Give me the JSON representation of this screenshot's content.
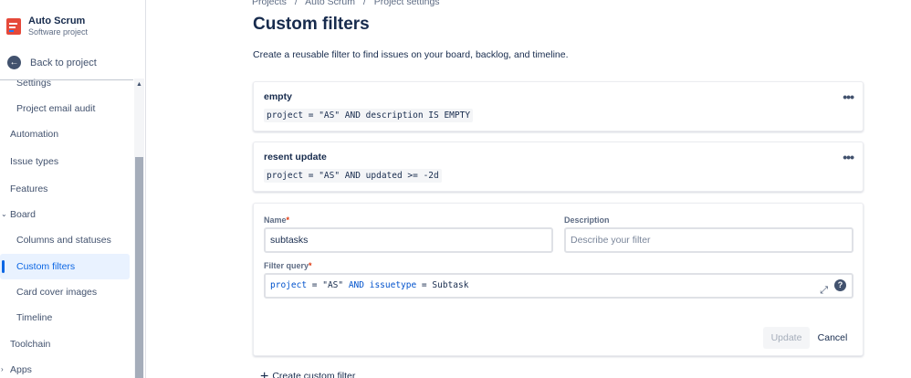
{
  "project": {
    "name": "Auto Scrum",
    "type": "Software project"
  },
  "sidebar": {
    "back_label": "Back to project",
    "items": [
      {
        "label": "Settings"
      },
      {
        "label": "Project email audit"
      },
      {
        "label": "Automation"
      },
      {
        "label": "Issue types"
      },
      {
        "label": "Features"
      },
      {
        "label": "Board"
      },
      {
        "label": "Columns and statuses"
      },
      {
        "label": "Custom filters"
      },
      {
        "label": "Card cover images"
      },
      {
        "label": "Timeline"
      },
      {
        "label": "Toolchain"
      },
      {
        "label": "Apps"
      }
    ]
  },
  "breadcrumbs": [
    "Projects",
    "/",
    "Auto Scrum",
    "/",
    "Project settings"
  ],
  "page": {
    "title": "Custom filters",
    "description": "Create a reusable filter to find issues on your board, backlog, and timeline."
  },
  "filters": [
    {
      "name": "empty",
      "query": "project = \"AS\" AND description IS EMPTY"
    },
    {
      "name": "resent update",
      "query": "project = \"AS\" AND updated >= -2d"
    }
  ],
  "form": {
    "name_label": "Name",
    "name_required": "*",
    "name_value": "subtasks",
    "description_label": "Description",
    "description_placeholder": "Describe your filter",
    "query_label": "Filter query",
    "query_required": "*",
    "query_tokens": [
      "project",
      " = ",
      "\"AS\"",
      " AND ",
      "issuetype",
      " = ",
      "Subtask"
    ],
    "update_label": "Update",
    "cancel_label": "Cancel"
  },
  "create_label": "Create custom filter",
  "more_icon_text": "•••",
  "colors": {
    "accent": "#0c66e4",
    "active_bg": "#e9f2ff",
    "text": "#172b4d",
    "keyword": "#0052cc"
  }
}
